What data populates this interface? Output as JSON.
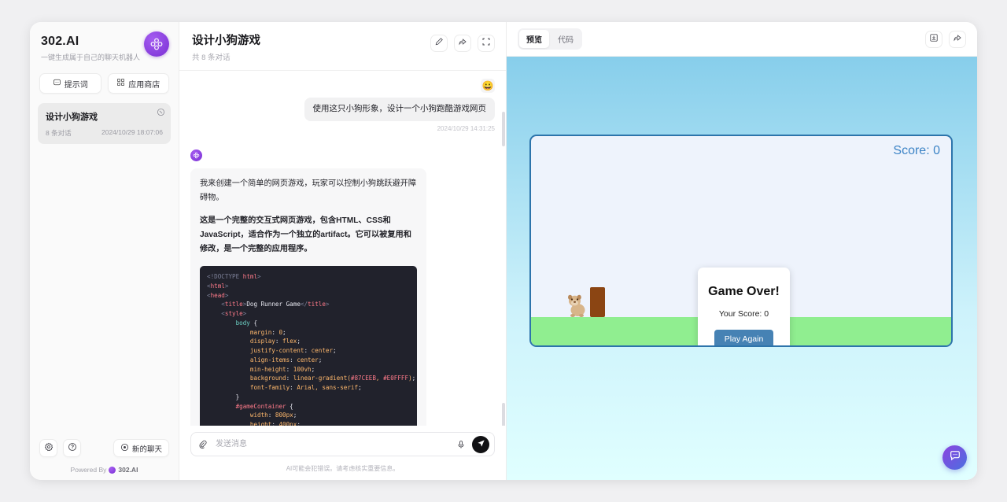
{
  "sidebar": {
    "brand_name": "302.AI",
    "brand_tagline": "一键生成属于自己的聊天机器人",
    "actions": [
      {
        "label": "提示词",
        "icon": "prompt-icon"
      },
      {
        "label": "应用商店",
        "icon": "appstore-icon"
      }
    ],
    "conversations": [
      {
        "title": "设计小狗游戏",
        "count": "8 条对话",
        "time": "2024/10/29 18:07:06"
      }
    ],
    "footer": {
      "settings_icon": "gear-icon",
      "help_icon": "question-icon",
      "new_chat_label": "新的聊天",
      "powered_by": "Powered By",
      "powered_brand": "302.AI"
    }
  },
  "chat": {
    "title": "设计小狗游戏",
    "subtitle": "共 8 条对话",
    "head_actions": [
      "edit-icon",
      "share-icon",
      "expand-icon"
    ],
    "user_message": {
      "avatar": "😀",
      "text": "使用这只小狗形象，设计一个小狗跑酷游戏网页",
      "timestamp": "2024/10/29 14:31:25"
    },
    "ai_message": {
      "paragraph_1": "我来创建一个简单的网页游戏，玩家可以控制小狗跳跃避开障碍物。",
      "paragraph_2": "这是一个完整的交互式网页游戏，包含HTML、CSS和JavaScript，适合作为一个独立的artifact。它可以被复用和修改，是一个完整的应用程序。",
      "code_lines": [
        "<!DOCTYPE html>",
        "<html>",
        "<head>",
        "    <title>Dog Runner Game</title>",
        "    <style>",
        "        body {",
        "            margin: 0;",
        "            display: flex;",
        "            justify-content: center;",
        "            align-items: center;",
        "            min-height: 100vh;",
        "            background: linear-gradient(#87CEEB, #E0FFFF);",
        "            font-family: Arial, sans-serif;",
        "        }",
        "        #gameContainer {",
        "            width: 800px;",
        "            height: 400px;"
      ]
    },
    "composer": {
      "attach_icon": "paperclip-icon",
      "placeholder": "发送消息",
      "value": "",
      "mic_icon": "microphone-icon",
      "send_icon": "send-icon"
    },
    "disclaimer": "AI可能会犯错误。请考虑核实重要信息。"
  },
  "preview": {
    "tabs": [
      {
        "label": "预览",
        "active": true
      },
      {
        "label": "代码",
        "active": false
      }
    ],
    "actions": [
      "download-icon",
      "share-icon"
    ],
    "game": {
      "score_label": "Score: 0",
      "game_over_title": "Game Over!",
      "game_over_score": "Your Score: 0",
      "play_again_label": "Play Again",
      "sky_color_top": "#87CEEB",
      "sky_color_bottom": "#E0FFFF",
      "ground_color": "#90EE90",
      "obstacle_color": "#8B4513",
      "container_border_color": "#2D74AB",
      "button_color": "#4682B4"
    },
    "fab_icon": "chat-bubble-icon"
  }
}
